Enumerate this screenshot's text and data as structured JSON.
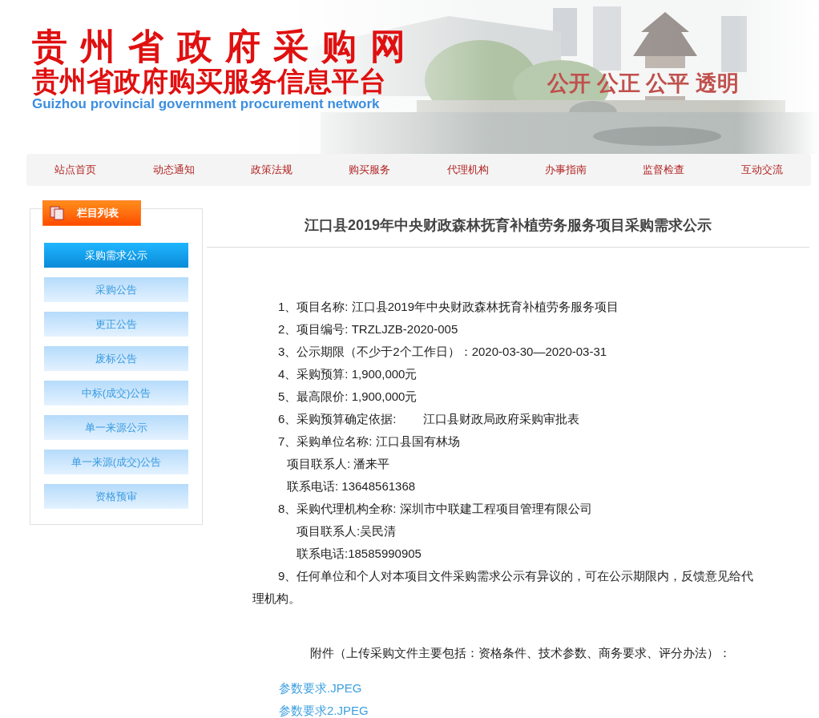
{
  "header": {
    "title": "贵 州 省 政 府 采 购 网",
    "subtitle": "贵州省政府购买服务信息平台",
    "english": "Guizhou provincial government procurement network",
    "slogan": "公开 公正 公平 透明"
  },
  "nav": [
    "站点首页",
    "动态通知",
    "政策法规",
    "购买服务",
    "代理机构",
    "办事指南",
    "监督检查",
    "互动交流"
  ],
  "sidebar": {
    "title": "栏目列表",
    "items": [
      {
        "label": "采购需求公示",
        "selected": true
      },
      {
        "label": "采购公告",
        "selected": false
      },
      {
        "label": "更正公告",
        "selected": false
      },
      {
        "label": "废标公告",
        "selected": false
      },
      {
        "label": "中标(成交)公告",
        "selected": false
      },
      {
        "label": "单一来源公示",
        "selected": false
      },
      {
        "label": "单一来源(成交)公告",
        "selected": false
      },
      {
        "label": "资格预审",
        "selected": false
      }
    ]
  },
  "article": {
    "title": "江口县2019年中央财政森林抚育补植劳务服务项目采购需求公示",
    "lines": [
      {
        "kind": "item",
        "text": "1、项目名称: 江口县2019年中央财政森林抚育补植劳务服务项目"
      },
      {
        "kind": "item",
        "text": "2、项目编号: TRZLJZB-2020-005"
      },
      {
        "kind": "item",
        "text": "3、公示期限（不少于2个工作日）：2020-03-30—2020-03-31"
      },
      {
        "kind": "item",
        "text": "4、采购预算: 1,900,000元"
      },
      {
        "kind": "item",
        "text": "5、最高限价: 1,900,000元"
      },
      {
        "kind": "item",
        "text": "6、采购预算确定依据:        江口县财政局政府采购审批表"
      },
      {
        "kind": "item",
        "text": "7、采购单位名称: 江口县国有林场"
      },
      {
        "kind": "contact",
        "text": "项目联系人: 潘来平"
      },
      {
        "kind": "contact",
        "text": "联系电话: 13648561368"
      },
      {
        "kind": "item",
        "text": "8、采购代理机构全称: 深圳市中联建工程项目管理有限公司"
      },
      {
        "kind": "agent-contact",
        "text": "项目联系人:吴民清"
      },
      {
        "kind": "agent-contact",
        "text": "联系电话:18585990905"
      },
      {
        "kind": "paragraph",
        "text": "9、任何单位和个人对本项目文件采购需求公示有异议的，可在公示期限内，反馈意见给代理机构。"
      }
    ],
    "attachments_note": "附件（上传采购文件主要包括：资格条件、技术参数、商务要求、评分办法）：",
    "attachments": [
      "参数要求.JPEG",
      "参数要求2.JPEG"
    ]
  }
}
